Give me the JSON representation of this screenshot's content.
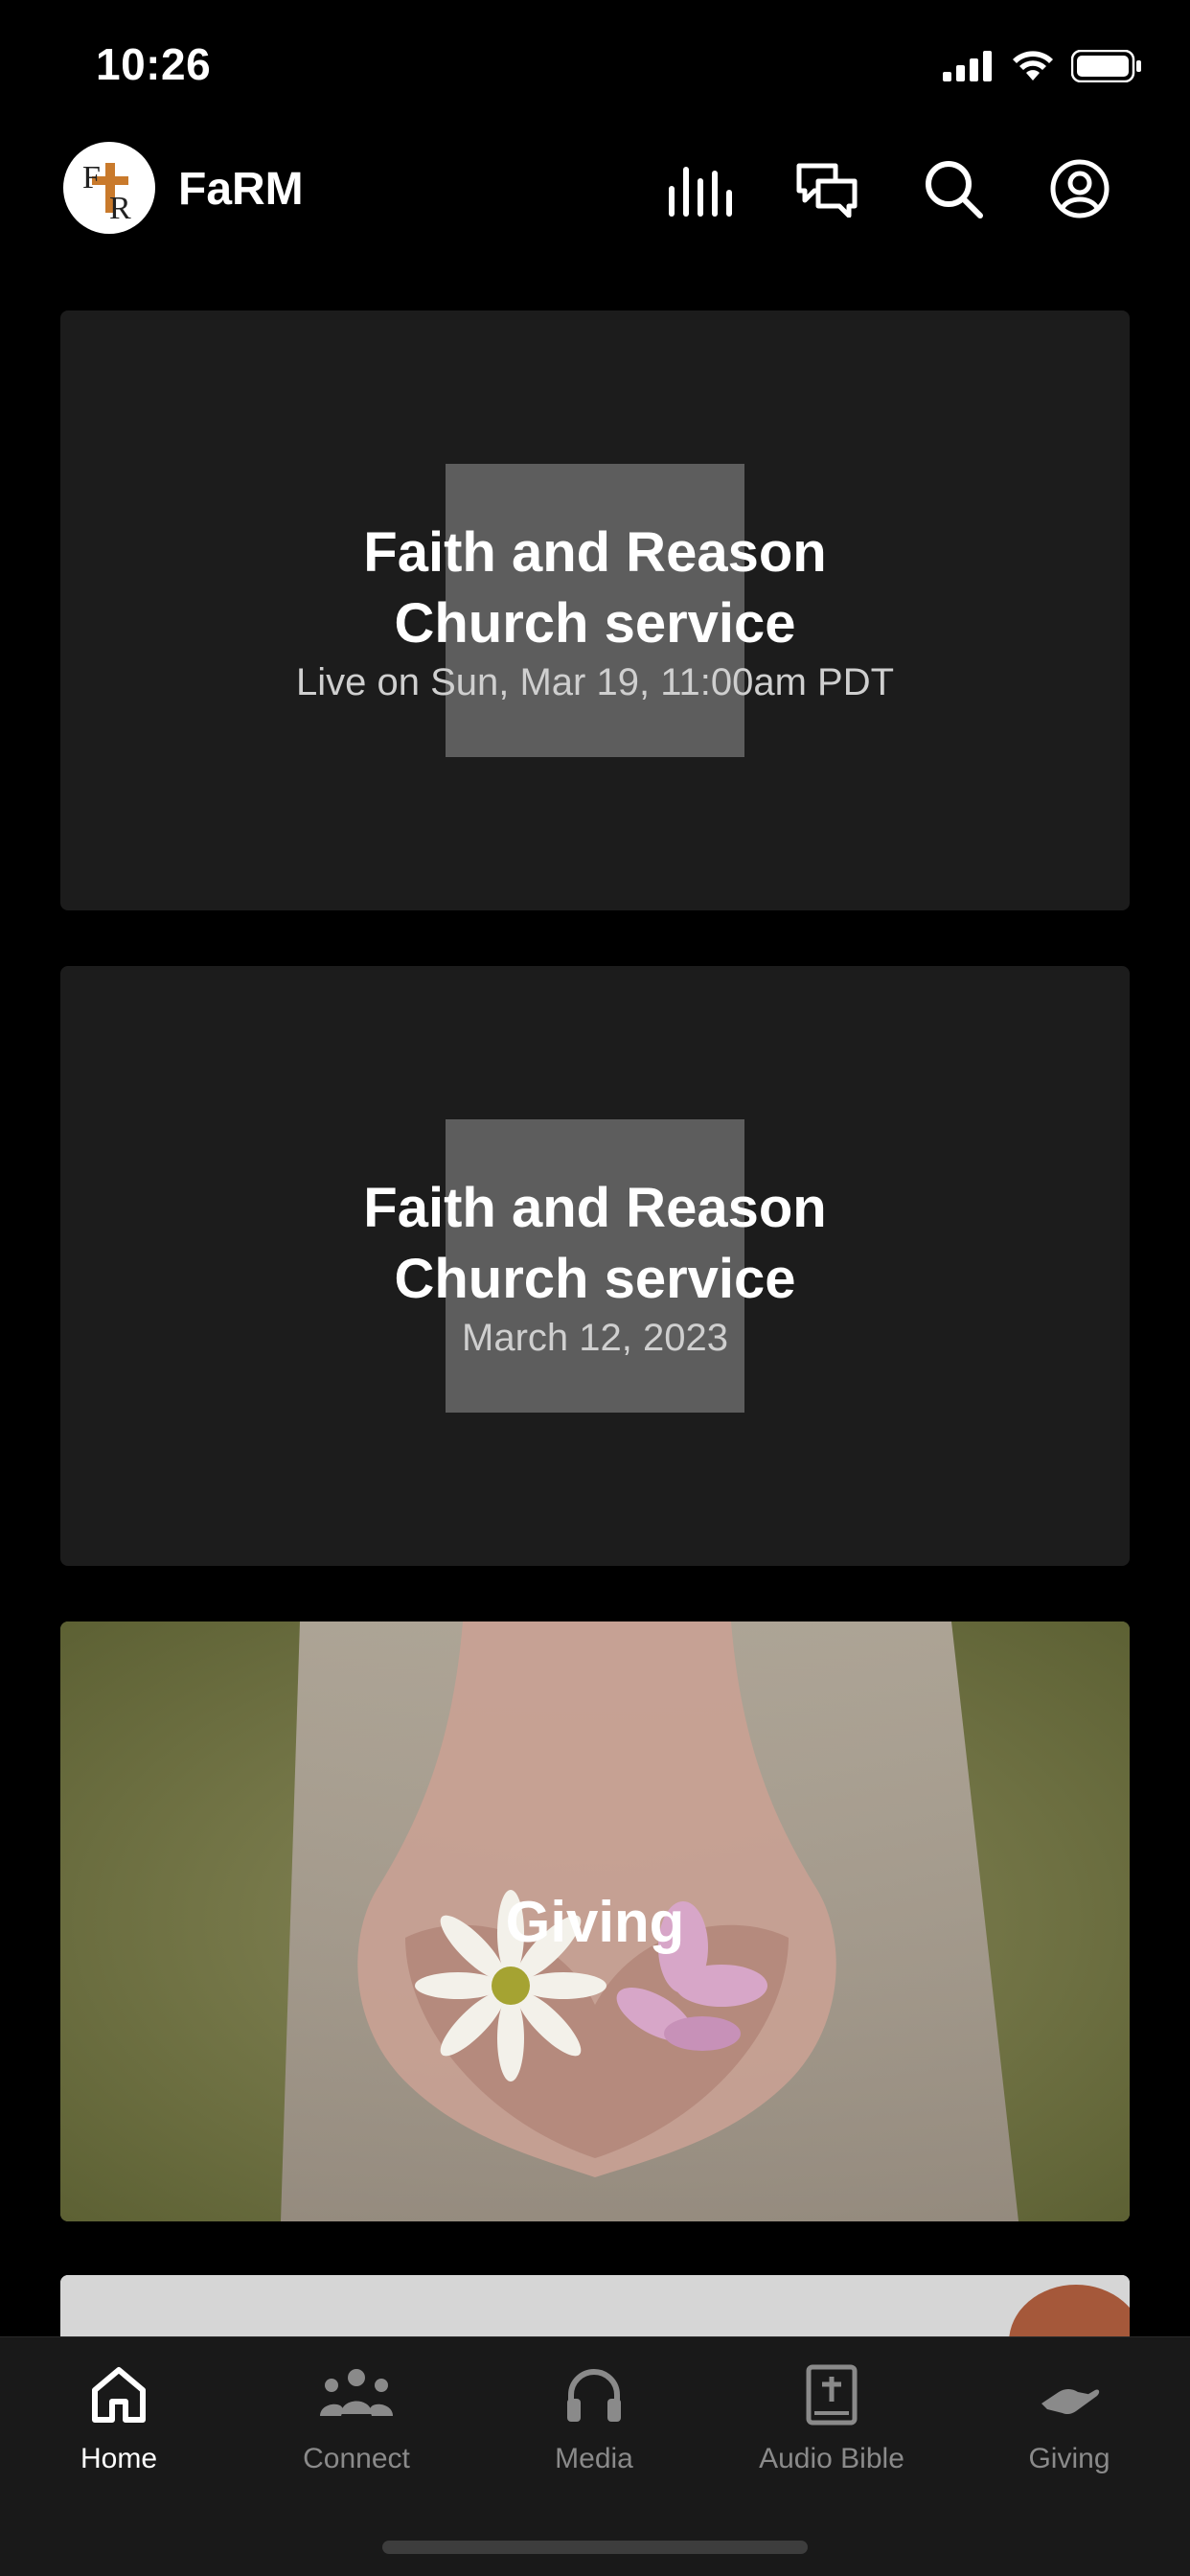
{
  "status_bar": {
    "time": "10:26"
  },
  "header": {
    "logo_text": "FR",
    "app_name": "FaRM",
    "icons": [
      "equalizer-icon",
      "chat-icon",
      "search-icon",
      "profile-icon"
    ]
  },
  "cards": [
    {
      "title_line1": "Faith and Reason",
      "title_line2": "Church service",
      "subtitle": "Live on Sun, Mar 19, 11:00am PDT"
    },
    {
      "title_line1": "Faith and Reason",
      "title_line2": "Church service",
      "subtitle": "March 12, 2023"
    },
    {
      "title": "Giving"
    }
  ],
  "tabs": [
    {
      "label": "Home",
      "icon": "home-icon",
      "active": true
    },
    {
      "label": "Connect",
      "icon": "group-icon",
      "active": false
    },
    {
      "label": "Media",
      "icon": "headphones-icon",
      "active": false
    },
    {
      "label": "Audio Bible",
      "icon": "bible-icon",
      "active": false
    },
    {
      "label": "Giving",
      "icon": "giving-hand-icon",
      "active": false
    }
  ],
  "colors": {
    "background": "#000000",
    "card": "#1c1c1c",
    "tab_inactive": "#8a8a8a",
    "tab_active": "#ffffff"
  }
}
